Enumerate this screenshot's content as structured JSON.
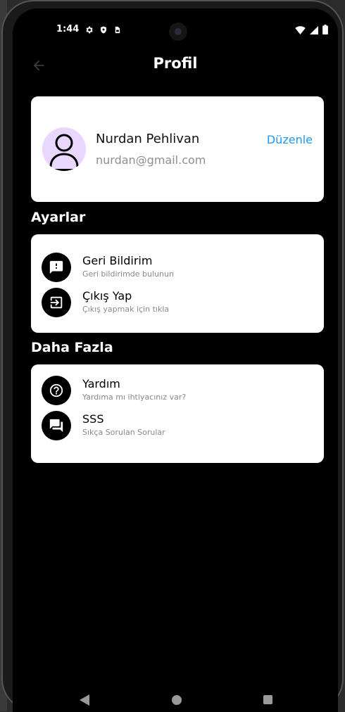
{
  "status_bar": {
    "time": "1:44",
    "left_icons": [
      "gear-icon",
      "shield-icon",
      "sim-card-icon"
    ],
    "right_icons": [
      "wifi-icon",
      "signal-icon",
      "battery-icon"
    ]
  },
  "header": {
    "title": "Profil",
    "back_icon": "arrow-left-icon"
  },
  "profile": {
    "name": "Nurdan Pehlivan",
    "email": "nurdan@gmail.com",
    "edit_label": "Düzenle",
    "avatar_icon": "person-icon"
  },
  "sections": [
    {
      "title": "Ayarlar",
      "items": [
        {
          "title": "Geri Bildirim",
          "subtitle": "Geri bildirimde bulunun",
          "icon": "feedback-icon"
        },
        {
          "title": "Çıkış Yap",
          "subtitle": "Çıkış yapmak için tıkla",
          "icon": "logout-icon"
        }
      ]
    },
    {
      "title": "Daha Fazla",
      "items": [
        {
          "title": "Yardım",
          "subtitle": "Yardıma mı ihtiyacınız var?",
          "icon": "help-icon"
        },
        {
          "title": "SSS",
          "subtitle": "Sıkça Sorulan Sorular",
          "icon": "forum-icon"
        }
      ]
    }
  ],
  "colors": {
    "background": "#000000",
    "card": "#ffffff",
    "accent": "#2196f3",
    "avatar_bg": "#e9d7ff",
    "subtext": "#888888"
  }
}
